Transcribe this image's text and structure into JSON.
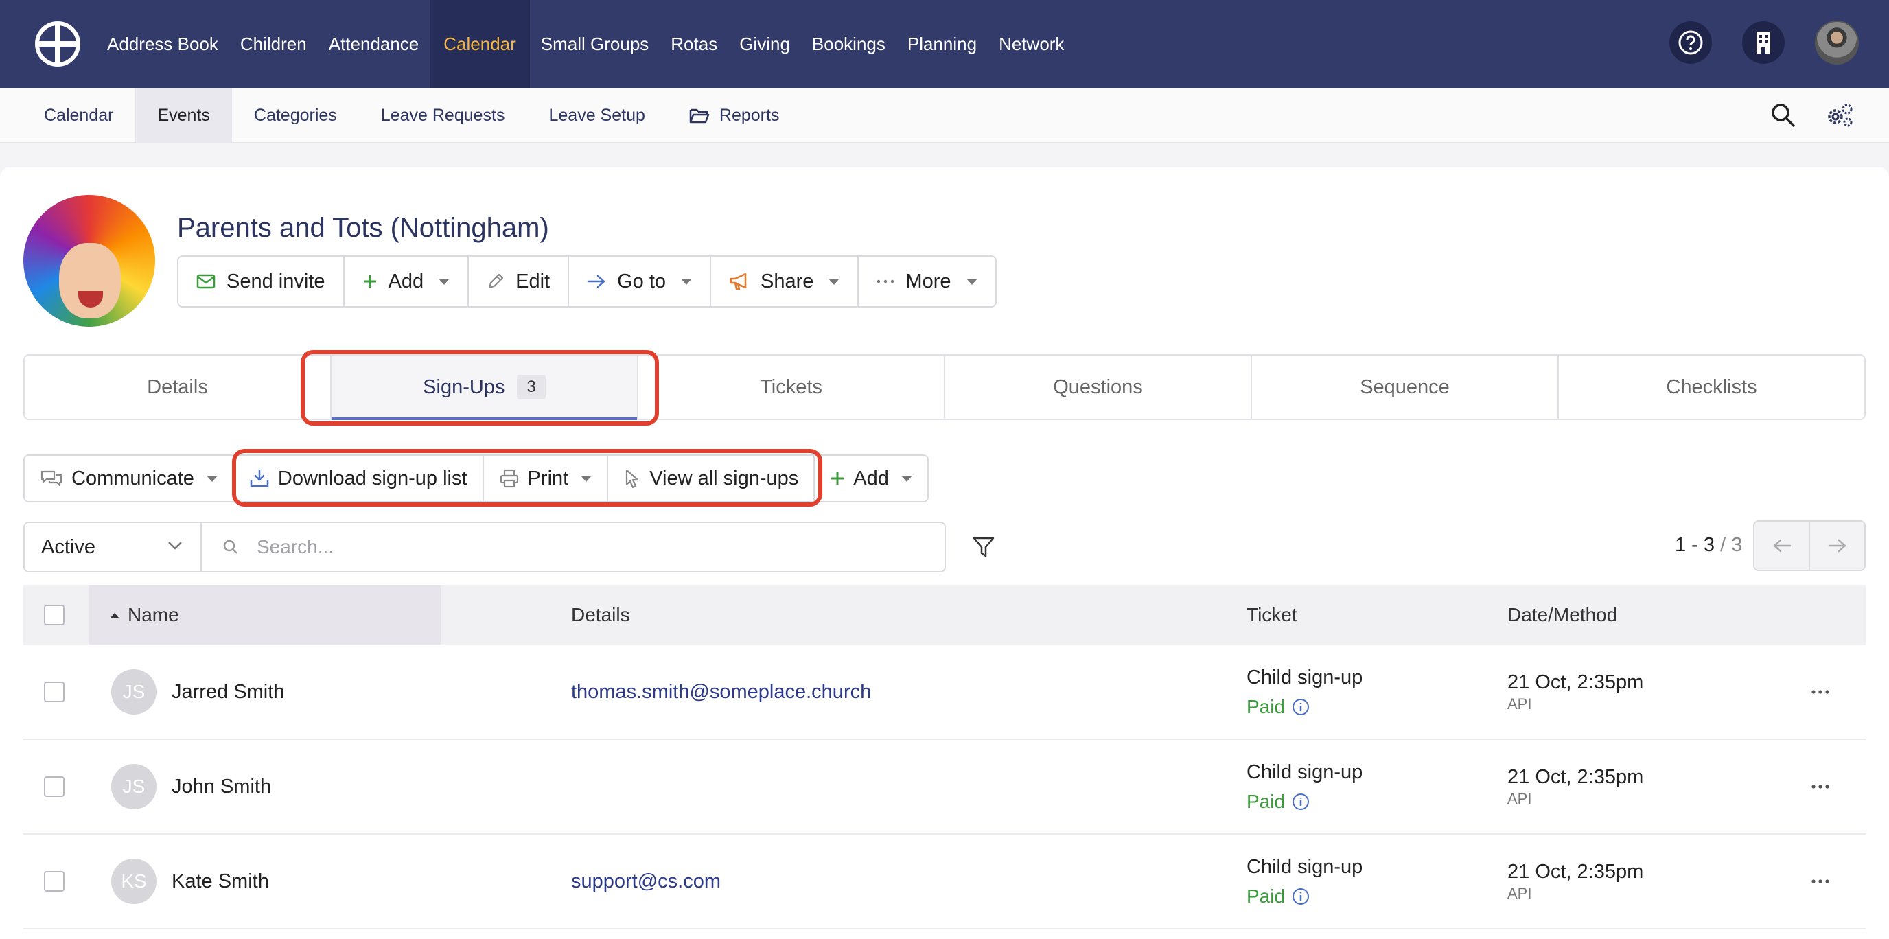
{
  "topnav": {
    "items": [
      "Address Book",
      "Children",
      "Attendance",
      "Calendar",
      "Small Groups",
      "Rotas",
      "Giving",
      "Bookings",
      "Planning",
      "Network"
    ],
    "active": "Calendar"
  },
  "subnav": {
    "items": [
      "Calendar",
      "Events",
      "Categories",
      "Leave Requests",
      "Leave Setup",
      "Reports"
    ],
    "active": "Events"
  },
  "event": {
    "title": "Parents and Tots (Nottingham)",
    "actions": [
      "Send invite",
      "Add",
      "Edit",
      "Go to",
      "Share",
      "More"
    ]
  },
  "tabs": {
    "items": [
      "Details",
      "Sign-Ups",
      "Tickets",
      "Questions",
      "Sequence",
      "Checklists"
    ],
    "active": "Sign-Ups",
    "signups_count": "3"
  },
  "toolbar": {
    "communicate": "Communicate",
    "download": "Download sign-up list",
    "print": "Print",
    "view_all": "View all sign-ups",
    "add": "Add"
  },
  "filters": {
    "status": "Active",
    "search_placeholder": "Search...",
    "range": "1 - 3",
    "total": " / 3"
  },
  "table": {
    "headers": {
      "name": "Name",
      "details": "Details",
      "ticket": "Ticket",
      "date": "Date/Method"
    },
    "rows": [
      {
        "initials": "JS",
        "name": "Jarred Smith",
        "details": "thomas.smith@someplace.church",
        "ticket": "Child sign-up",
        "status": "Paid",
        "date": "21 Oct, 2:35pm",
        "method": "API"
      },
      {
        "initials": "JS",
        "name": "John Smith",
        "details": "",
        "ticket": "Child sign-up",
        "status": "Paid",
        "date": "21 Oct, 2:35pm",
        "method": "API"
      },
      {
        "initials": "KS",
        "name": "Kate Smith",
        "details": "support@cs.com",
        "ticket": "Child sign-up",
        "status": "Paid",
        "date": "21 Oct, 2:35pm",
        "method": "API"
      }
    ]
  },
  "colors": {
    "nav_bg": "#333b6b",
    "accent": "#f3b441",
    "highlight": "#e2402f",
    "paid": "#3a9b3a"
  }
}
